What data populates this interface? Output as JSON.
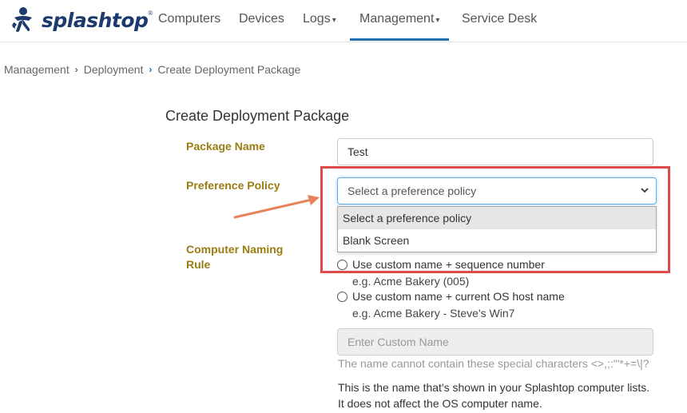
{
  "brand": {
    "name": "splashtop",
    "registered": "®"
  },
  "nav": {
    "items": [
      {
        "label": "Computers"
      },
      {
        "label": "Devices"
      },
      {
        "label": "Logs",
        "caret": "▾"
      },
      {
        "label": "Management",
        "caret": "▾",
        "active": true
      },
      {
        "label": "Service Desk"
      }
    ]
  },
  "breadcrumb": {
    "items": [
      "Management",
      "Deployment",
      "Create Deployment Package"
    ],
    "separator": "›"
  },
  "form": {
    "title": "Create Deployment Package",
    "package_name": {
      "label": "Package Name",
      "value": "Test"
    },
    "preference_policy": {
      "label": "Preference Policy",
      "selected": "Select a preference policy",
      "options": [
        "Select a preference policy",
        "Blank Screen"
      ]
    },
    "naming_rule": {
      "label_line1": "Computer Naming",
      "label_line2": "Rule",
      "options": [
        {
          "label": "Use custom name + sequence number",
          "example": "e.g. Acme Bakery (005)"
        },
        {
          "label": "Use custom name + current OS host name",
          "example": "e.g. Acme Bakery - Steve's Win7"
        }
      ],
      "custom_name_placeholder": "Enter Custom Name",
      "help_text": "The name cannot contain these special characters <>,;:\"'*+=\\|?",
      "note_line1": "This is the name that's shown in your Splashtop computer lists.",
      "note_line2": "It does not affect the OS computer name."
    }
  },
  "colors": {
    "brand": "#1c3a6e",
    "accent": "#1f6fb2",
    "label_gold": "#9a7d12",
    "annotation_red": "#e04a4a",
    "annotation_arrow": "#e8825a"
  }
}
